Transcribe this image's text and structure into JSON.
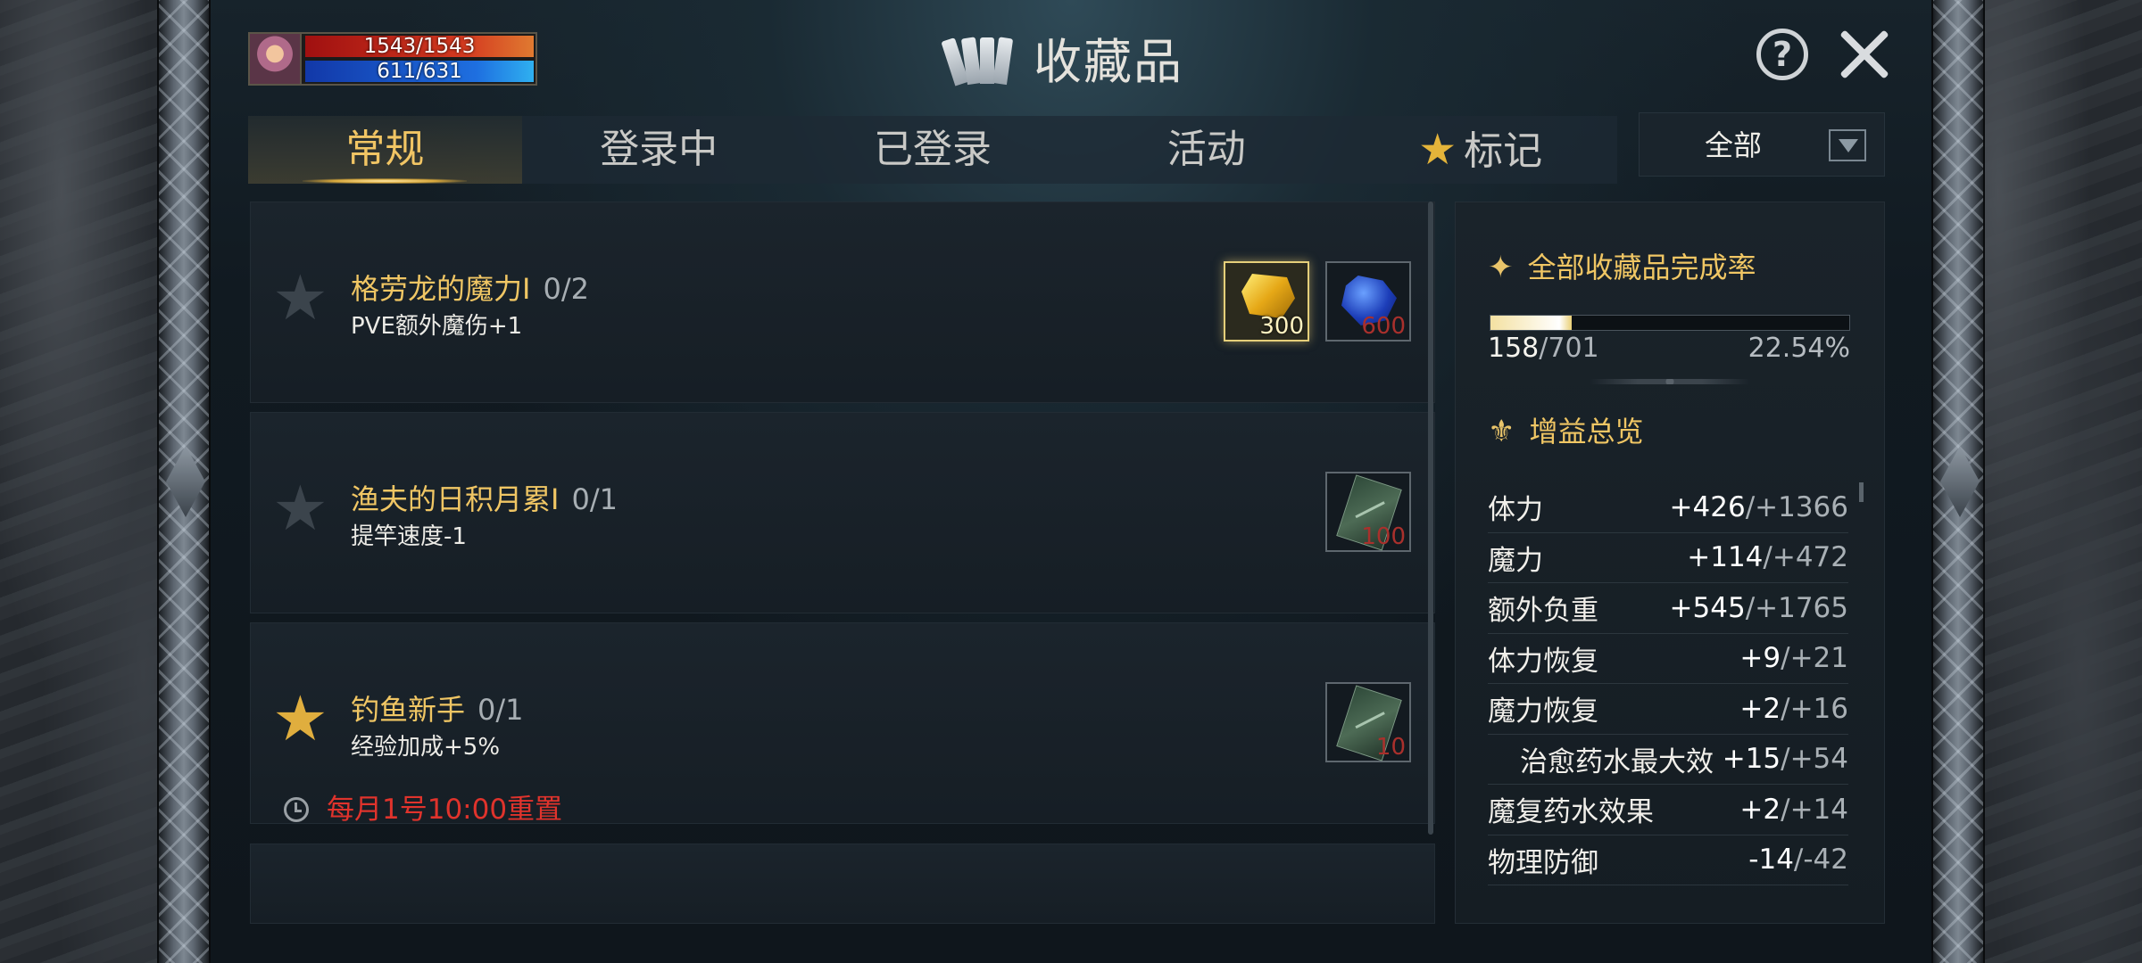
{
  "status": {
    "hp": "1543/1543",
    "mp": "611/631",
    "hp_fraction": 1.0,
    "mp_fraction": 0.968
  },
  "header": {
    "title": "收藏品",
    "help_icon": "question-icon",
    "close_icon": "close-icon"
  },
  "tabs": [
    {
      "label": "常规",
      "active": true
    },
    {
      "label": "登录中",
      "active": false
    },
    {
      "label": "已登录",
      "active": false
    },
    {
      "label": "活动",
      "active": false
    },
    {
      "label": "标记",
      "icon": "star-icon",
      "active": false
    }
  ],
  "filter": {
    "selected": "全部"
  },
  "collections": [
    {
      "name": "格劳龙的魔力Ⅰ",
      "progress": "0/2",
      "desc": "PVE额外魔伤+1",
      "starred": false,
      "rewards": [
        {
          "icon": "gold-ore-icon",
          "qty": "300",
          "highlight": true
        },
        {
          "icon": "blue-gem-icon",
          "qty": "600",
          "highlight": false
        }
      ]
    },
    {
      "name": "渔夫的日积月累Ⅰ",
      "progress": "0/1",
      "desc": "提竿速度-1",
      "starred": false,
      "rewards": [
        {
          "icon": "card-item-icon",
          "qty": "100",
          "highlight": false
        }
      ]
    },
    {
      "name": "钓鱼新手",
      "progress": "0/1",
      "desc": "经验加成+5%",
      "starred": true,
      "reset": "每月1号10:00重置",
      "rewards": [
        {
          "icon": "card-item-icon",
          "qty": "10",
          "highlight": false
        }
      ]
    }
  ],
  "summary": {
    "completion_title": "全部收藏品完成率",
    "current": "158",
    "total": "/701",
    "percent": "22.54%",
    "progress_fraction": 0.2254,
    "buffs_title": "增益总览",
    "stats": [
      {
        "label": "体力",
        "cur": "+426",
        "max": "/+1366"
      },
      {
        "label": "魔力",
        "cur": "+114",
        "max": "/+472"
      },
      {
        "label": "额外负重",
        "cur": "+545",
        "max": "/+1765"
      },
      {
        "label": "体力恢复",
        "cur": "+9",
        "max": "/+21"
      },
      {
        "label": "魔力恢复",
        "cur": "+2",
        "max": "/+16"
      },
      {
        "label": "治愈药水最大效",
        "cur": "+15",
        "max": "/+54",
        "indent": true
      },
      {
        "label": "魔复药水效果",
        "cur": "+2",
        "max": "/+14"
      },
      {
        "label": "物理防御",
        "cur": "-14",
        "max": "/-42"
      }
    ]
  }
}
